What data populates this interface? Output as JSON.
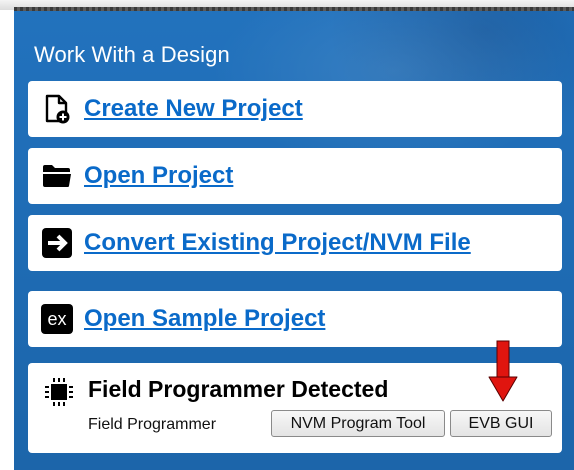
{
  "header": {
    "title": "Work With a Design"
  },
  "actions": [
    {
      "label": "Create New Project",
      "icon": "new-file-icon"
    },
    {
      "label": "Open Project",
      "icon": "folder-icon"
    },
    {
      "label": "Convert Existing Project/NVM File",
      "icon": "convert-arrow-icon"
    },
    {
      "label": "Open Sample Project",
      "icon": "sample-ex-icon",
      "icon_text": "ex"
    }
  ],
  "programmer": {
    "title": "Field Programmer Detected",
    "label": "Field Programmer",
    "nvm_button": "NVM Program Tool",
    "evb_button": "EVB GUI",
    "icon": "chip-icon",
    "annotation": {
      "type": "arrow",
      "color": "#e0150f",
      "points_to": "evb_button"
    }
  },
  "colors": {
    "panel": "#1f6db6",
    "link": "#0a6ac9",
    "card": "#ffffff",
    "annotation": "#e0150f"
  }
}
